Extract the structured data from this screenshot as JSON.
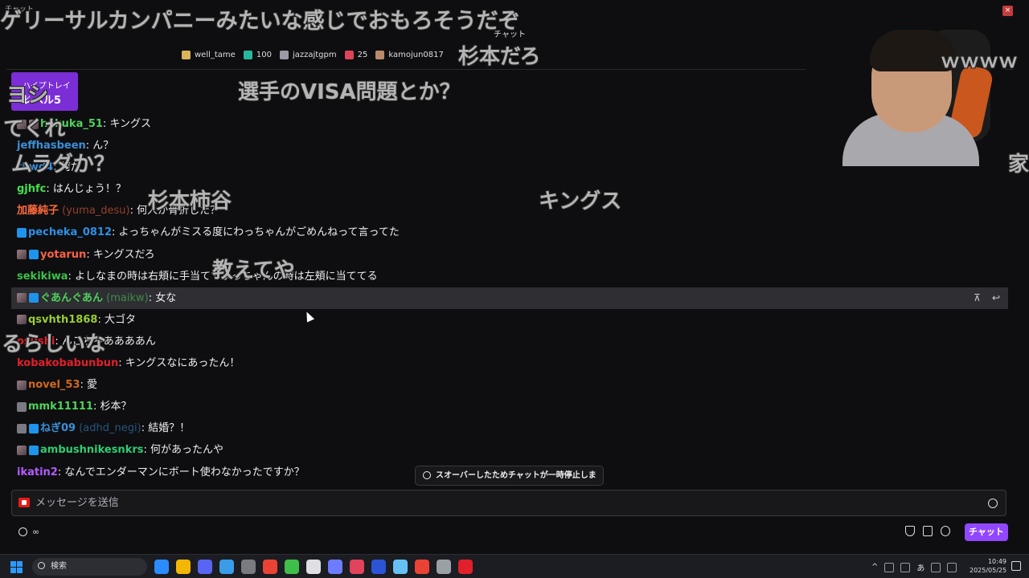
{
  "window": {
    "title": "チャット",
    "pane_title": "チャット",
    "close_glyph": "×"
  },
  "leaderboard": [
    {
      "name": "well_tame",
      "color": "#d9b45a"
    },
    {
      "name": "100",
      "color": "#27b89c"
    },
    {
      "name": "jazzajtgpm",
      "color": "#9a9aa5"
    },
    {
      "name": "25",
      "color": "#e0435a"
    },
    {
      "name": "kamojun0817",
      "color": "#b98a6a"
    }
  ],
  "hype_train": {
    "label": "ハイプトレイン",
    "level": "レベル5"
  },
  "messages": [
    {
      "badges": [
        "img",
        "img"
      ],
      "user": "hakuka_51",
      "login": "",
      "color": "#4fd25a",
      "text": ": キングス"
    },
    {
      "badges": [],
      "user": "jeffhasbeen",
      "login": "",
      "color": "#3c8fd6",
      "text": ": ん？"
    },
    {
      "badges": [],
      "user": "tkwd4",
      "login": "",
      "color": "#3c8fd6",
      "text": ": 何だ"
    },
    {
      "badges": [],
      "user": "gjhfc",
      "login": "",
      "color": "#44e04c",
      "text": ": はんじょう！？"
    },
    {
      "badges": [],
      "user": "加藤純子",
      "login": " (yuma_desu)",
      "color": "#ff6b3d",
      "text": ": 何人か骨折した？"
    },
    {
      "badges": [
        "prime"
      ],
      "user": "pecheka_0812",
      "login": "",
      "color": "#2f8fe6",
      "text": ": よっちゃんがミスる度にわっちゃんがごめんねって言ってた"
    },
    {
      "badges": [
        "img",
        "prime"
      ],
      "user": "yotarun",
      "login": "",
      "color": "#ff6145",
      "text": ": キングスだろ"
    },
    {
      "badges": [],
      "user": "sekikiwa",
      "login": "",
      "color": "#3fbf49",
      "text": ": よしなまの時は右頬に手当ててよっちゃんの時は左頬に当ててる"
    },
    {
      "badges": [
        "img",
        "prime"
      ],
      "user": "ぐあんぐあん",
      "login": " (maikw)",
      "color": "#4fd25a",
      "text": ": 女な"
    },
    {
      "badges": [
        "img"
      ],
      "user": "qsvhth1868",
      "login": "",
      "color": "#9acd32",
      "text": ": 大ゴタ"
    },
    {
      "badges": [],
      "user": "osushi",
      "login": "",
      "color": "#e0202a",
      "text": ": んこちゃああああん"
    },
    {
      "badges": [],
      "user": "kobakobabunbun",
      "login": "",
      "color": "#e0202a",
      "text": ": キングスなにあったん！"
    },
    {
      "badges": [
        "img"
      ],
      "user": "novel_53",
      "login": "",
      "color": "#d2691e",
      "text": ": 愛"
    },
    {
      "badges": [
        "sub"
      ],
      "user": "mmk11111",
      "login": "",
      "color": "#4fd25a",
      "text": ": 杉本？"
    },
    {
      "badges": [
        "sub",
        "prime"
      ],
      "user": "ねぎ09",
      "login": " (adhd_negi)",
      "color": "#3c8fd6",
      "text": ": 結婚？！"
    },
    {
      "badges": [
        "img",
        "prime"
      ],
      "user": "ambushnikesnkrs",
      "login": "",
      "color": "#2ecc71",
      "text": ": 何があったんや"
    },
    {
      "badges": [],
      "user": "ikatin2",
      "login": "",
      "color": "#b45cff",
      "text": ": なんでエンダーマンにボート使わなかったですか？"
    }
  ],
  "highlight_actions": {
    "pin_glyph": "⊼",
    "reply_glyph": "↩"
  },
  "pause_notice": "スオーバーしたためチャットが一時停止しま",
  "input": {
    "placeholder": "メッセージを送信"
  },
  "points": "∞",
  "send_button": "チャット",
  "danmaku": [
    {
      "text": "ゲリーサルカンパニーみたいな感じでおもろそうだぞ",
      "size": 27
    },
    {
      "text": "杉本だろ",
      "size": 26
    },
    {
      "text": "ｗｗｗｗ",
      "size": 24
    },
    {
      "text": "選手のVISA問題とか？",
      "size": 26
    },
    {
      "text": "ヨシ",
      "size": 26
    },
    {
      "text": "てくれ",
      "size": 26
    },
    {
      "text": "ムラダか？",
      "size": 26
    },
    {
      "text": "杉本柿谷",
      "size": 26
    },
    {
      "text": "キングス",
      "size": 26
    },
    {
      "text": "教えてや",
      "size": 26
    },
    {
      "text": "るらしいな",
      "size": 26
    },
    {
      "text": "家",
      "size": 26
    }
  ],
  "taskbar": {
    "search_label": "検索",
    "apps": [
      "#2b8cff",
      "#f2b705",
      "#5865f2",
      "#3a9be8",
      "#7a7a82",
      "#ea4335",
      "#3fbf49",
      "#dedee3",
      "#6d7cff",
      "#e0435a",
      "#2b54d6",
      "#66c0f4",
      "#ea4335",
      "#9aa0a6",
      "#e0202a"
    ],
    "ime": "あ",
    "time": "10:49",
    "date": "2025/05/25"
  }
}
